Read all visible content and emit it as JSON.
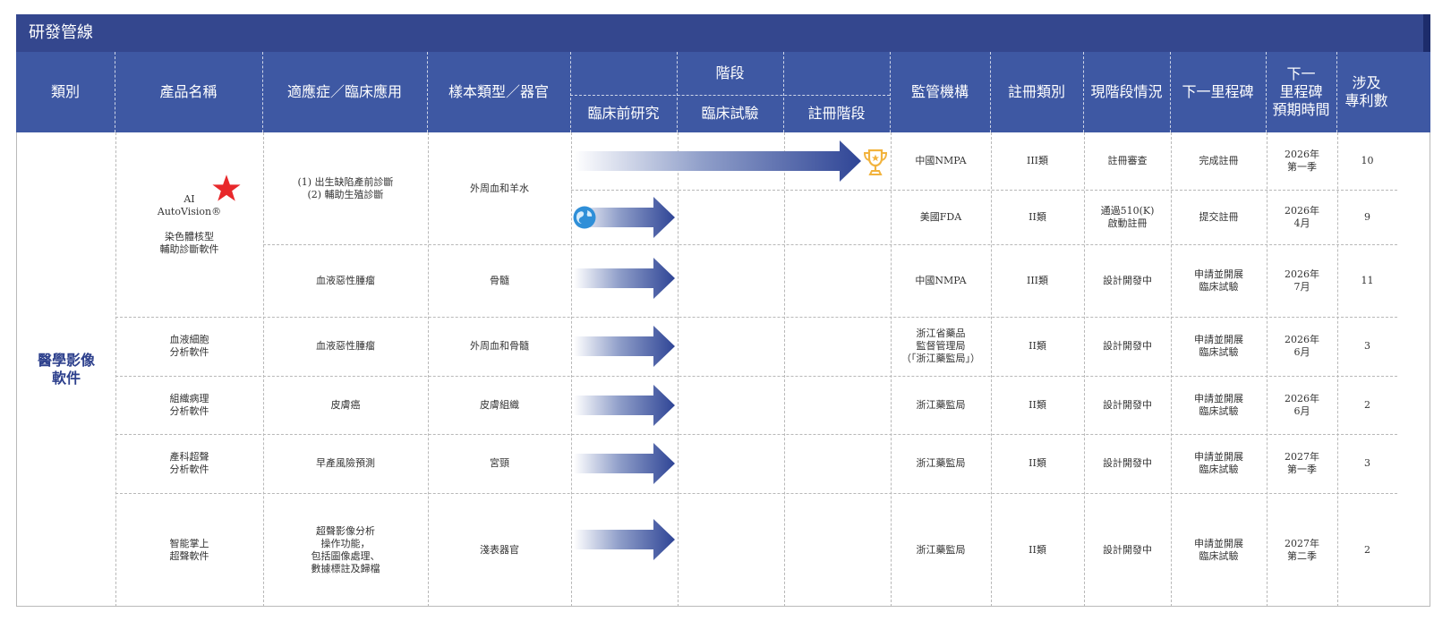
{
  "title": "研發管線",
  "headers": {
    "category": "類別",
    "product": "產品名稱",
    "indication": "適應症／臨床應用",
    "sample": "樣本類型／器官",
    "stage": "階段",
    "preclinical": "臨床前研究",
    "clinical": "臨床試驗",
    "registration": "註冊階段",
    "regulator": "監管機構",
    "reg_class": "註冊類別",
    "status": "現階段情況",
    "next": "下一里程碑",
    "next_time": "下一\n里程碑\n預期時間",
    "patents": "涉及\n專利數"
  },
  "category": "醫學影像\n軟件",
  "products": [
    {
      "name": "AI\nAutoVision®\n\n染色體核型\n輔助診斷軟件"
    },
    {
      "name": "血液細胞\n分析軟件"
    },
    {
      "name": "組織病理\n分析軟件"
    },
    {
      "name": "產科超聲\n分析軟件"
    },
    {
      "name": "智能掌上\n超聲軟件"
    }
  ],
  "indications": [
    {
      "text": "(1) 出生缺陷產前診斷\n(2) 輔助生殖診斷",
      "sample": "外周血和羊水"
    },
    {
      "text": "血液惡性腫瘤",
      "sample": "骨髓"
    },
    {
      "text": "血液惡性腫瘤",
      "sample": "外周血和骨髓"
    },
    {
      "text": "皮膚癌",
      "sample": "皮膚組織"
    },
    {
      "text": "早產風險預測",
      "sample": "宮頸"
    },
    {
      "text": "超聲影像分析\n操作功能，\n包括圖像處理、\n數據標註及歸檔",
      "sample": "淺表器官"
    }
  ],
  "rows": [
    {
      "regulator": "中國NMPA",
      "reg_class": "III類",
      "status": "註冊審查",
      "next": "完成註冊",
      "next_time": "2026年\n第一季",
      "patents": "10",
      "progress": 1.0
    },
    {
      "regulator": "美國FDA",
      "reg_class": "II類",
      "status": "通過510(K)\n啟動註冊",
      "next": "提交註冊",
      "next_time": "2026年\n4月",
      "patents": "9",
      "progress": 0.333
    },
    {
      "regulator": "中國NMPA",
      "reg_class": "III類",
      "status": "設計開發中",
      "next": "申請並開展\n臨床試驗",
      "next_time": "2026年\n7月",
      "patents": "11",
      "progress": 0.333
    },
    {
      "regulator": "浙江省藥品\n監督管理局\n（「浙江藥監局」）",
      "reg_class": "II類",
      "status": "設計開發中",
      "next": "申請並開展\n臨床試驗",
      "next_time": "2026年\n6月",
      "patents": "3",
      "progress": 0.333
    },
    {
      "regulator": "浙江藥監局",
      "reg_class": "II類",
      "status": "設計開發中",
      "next": "申請並開展\n臨床試驗",
      "next_time": "2026年\n6月",
      "patents": "2",
      "progress": 0.333
    },
    {
      "regulator": "浙江藥監局",
      "reg_class": "II類",
      "status": "設計開發中",
      "next": "申請並開展\n臨床試驗",
      "next_time": "2027年\n第一季",
      "patents": "3",
      "progress": 0.333
    },
    {
      "regulator": "浙江藥監局",
      "reg_class": "II類",
      "status": "設計開發中",
      "next": "申請並開展\n臨床試驗",
      "next_time": "2027年\n第二季",
      "patents": "2",
      "progress": 0.333
    }
  ],
  "colors": {
    "header": "#3e58a3",
    "title_bar": "#34478e",
    "arrow": "#2f4596",
    "star": "#e8282b",
    "trophy": "#f2b33d",
    "globe": "#2f8fd8"
  },
  "icons": {
    "star": "star-icon",
    "trophy": "trophy-icon",
    "globe": "globe-icon"
  }
}
